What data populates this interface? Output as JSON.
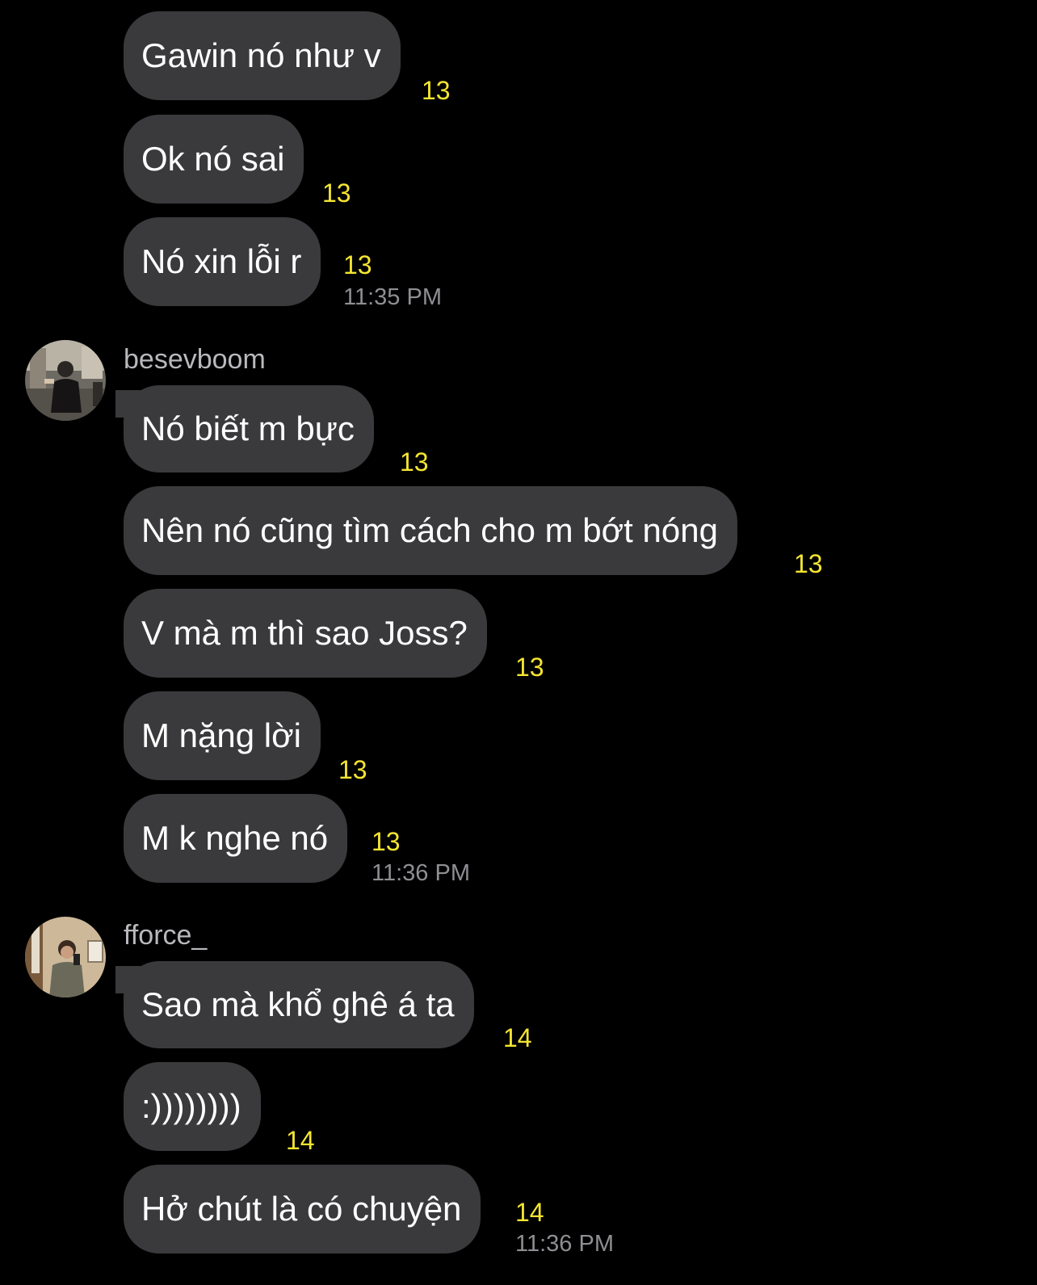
{
  "messages": [
    {
      "text": "Gawin nó như v",
      "count": "13"
    },
    {
      "text": "Ok nó sai",
      "count": "13"
    },
    {
      "text": "Nó xin lỗi r",
      "count": "13",
      "time": "11:35 PM"
    },
    {
      "text": "Nó biết m bực",
      "count": "13"
    },
    {
      "text": "Nên nó cũng tìm cách cho m bớt nóng",
      "count": "13"
    },
    {
      "text": "V mà m thì sao Joss?",
      "count": "13"
    },
    {
      "text": "M nặng lời",
      "count": "13"
    },
    {
      "text": "M k nghe nó",
      "count": "13",
      "time": "11:36 PM"
    },
    {
      "text": "Sao mà khổ ghê á ta",
      "count": "14"
    },
    {
      "text": ":))))))))",
      "count": "14"
    },
    {
      "text": "Hở chút là có chuyện",
      "count": "14",
      "time": "11:36 PM"
    }
  ],
  "senders": [
    {
      "name": "besevboom",
      "avatar_icon": "user-avatar-photo"
    },
    {
      "name": "fforce_",
      "avatar_icon": "user-avatar-photo"
    }
  ],
  "colors": {
    "background": "#000000",
    "bubble": "#3a3a3c",
    "count": "#f4e531",
    "timestamp": "#8e8e93"
  }
}
